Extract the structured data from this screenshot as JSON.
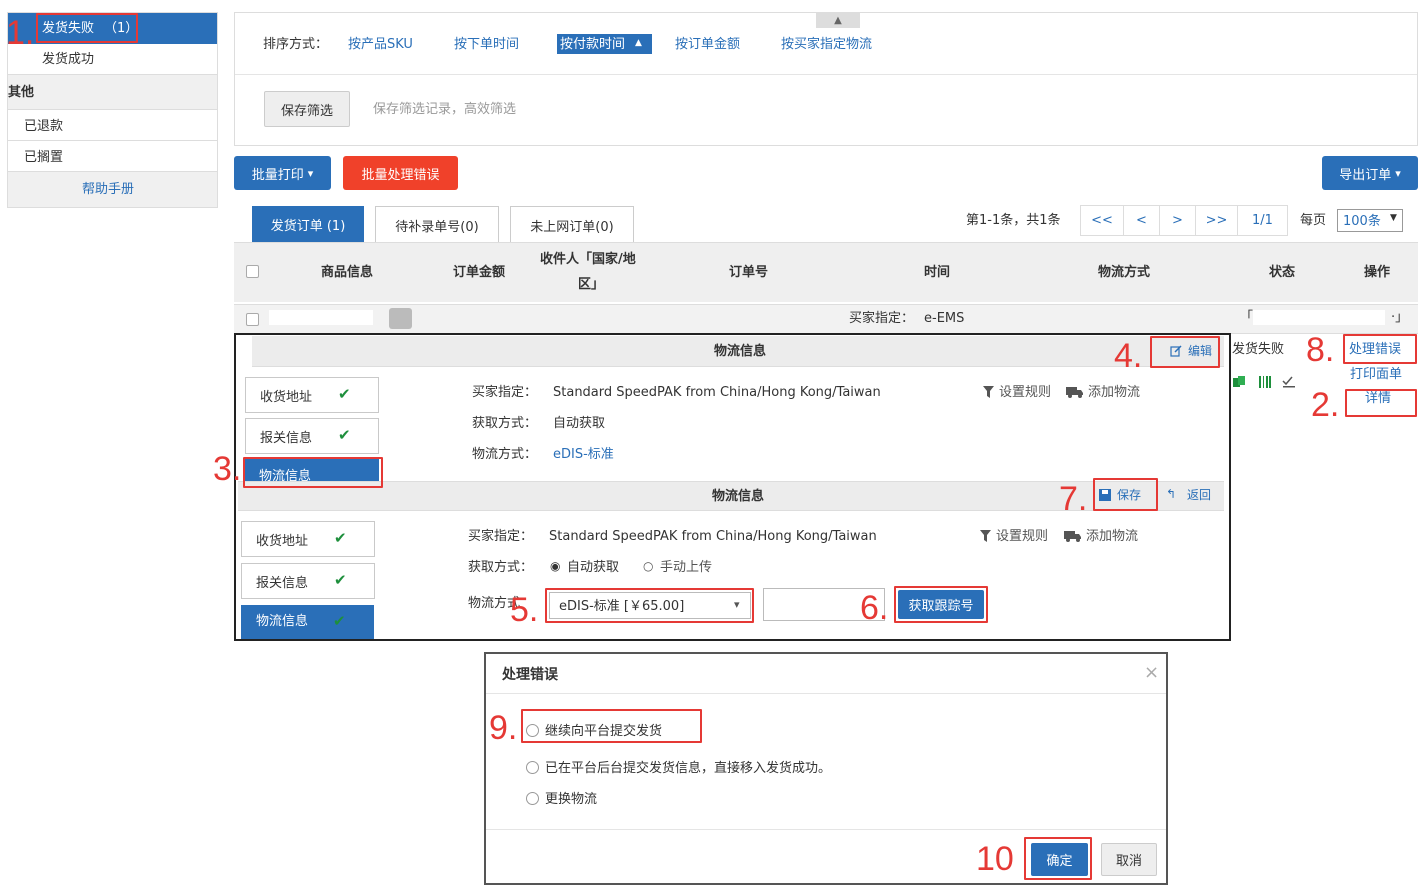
{
  "sidebar": {
    "items": [
      {
        "label": "发货失败",
        "count": "（1）"
      },
      {
        "label": "发货成功"
      }
    ],
    "section_other": "其他",
    "items_other": [
      "已退款",
      "已搁置"
    ],
    "help": "帮助手册"
  },
  "sort": {
    "label": "排序方式：",
    "options": [
      "按产品SKU",
      "按下单时间",
      "按付款时间",
      "按订单金额",
      "按买家指定物流"
    ],
    "active_arrow": "▲",
    "save_filter": "保存筛选",
    "save_hint": "保存筛选记录，高效筛选",
    "collapse_arrow": "▲"
  },
  "toolbar": {
    "print": "批量打印",
    "print_caret": "▾",
    "handle_errors": "批量处理错误",
    "export": "导出订单",
    "export_caret": "▾"
  },
  "tabs": [
    "发货订单 (1)",
    "待补录单号(0)",
    "未上网订单(0)"
  ],
  "pagination": {
    "summary": "第1-1条，共1条",
    "first": "<<",
    "prev": "<",
    "next": ">",
    "last": ">>",
    "page": "1/1",
    "per_page_label": "每页",
    "per_page": "100条"
  },
  "table": {
    "headers": [
      "商品信息",
      "订单金额",
      "收件人「国家/地区」",
      "订单号",
      "时间",
      "物流方式",
      "状态",
      "操作"
    ],
    "header_recipient": [
      "收件人「国家/地",
      "区」"
    ],
    "row": {
      "buyer_spec": "买家指定：",
      "buyer_logistics": "e-EMS",
      "status": "发货失败",
      "bracket_open": "「",
      "bracket_close": "·」"
    },
    "actions": {
      "handle_error": "处理错误",
      "print_label": "打印面单",
      "details": "详情"
    }
  },
  "panel1": {
    "title": "物流信息",
    "edit": "编辑",
    "tabs": [
      "收货地址",
      "报关信息",
      "物流信息"
    ],
    "buyer_spec_label": "买家指定：",
    "buyer_spec_value": "Standard SpeedPAK from China/Hong Kong/Taiwan",
    "fetch_label": "获取方式：",
    "fetch_value": "自动获取",
    "method_label": "物流方式：",
    "method_value": "eDIS-标准",
    "rules": "设置规则",
    "add_logistics": "添加物流"
  },
  "panel2": {
    "title": "物流信息",
    "save": "保存",
    "back": "返回",
    "tabs": [
      "收货地址",
      "报关信息",
      "物流信息"
    ],
    "buyer_spec_label": "买家指定：",
    "buyer_spec_value": "Standard SpeedPAK from China/Hong Kong/Taiwan",
    "fetch_label": "获取方式：",
    "fetch_auto": "自动获取",
    "fetch_manual": "手动上传",
    "method_label": "物流方式",
    "method_select": "eDIS-标准 [￥65.00]",
    "method_caret": "▾",
    "get_tracking": "获取跟踪号",
    "rules": "设置规则",
    "add_logistics": "添加物流"
  },
  "dialog": {
    "title": "处理错误",
    "close": "×",
    "options": [
      "继续向平台提交发货",
      "已在平台后台提交发货信息，直接移入发货成功。",
      "更换物流"
    ],
    "confirm": "确定",
    "cancel": "取消"
  },
  "callouts": [
    "1.",
    "2.",
    "3.",
    "4.",
    "5.",
    "6.",
    "7.",
    "8.",
    "9.",
    "10"
  ],
  "colors": {
    "accent": "#2a6fb8",
    "danger": "#f0412a",
    "callout": "#e53935",
    "ok": "#1e8f3c"
  }
}
